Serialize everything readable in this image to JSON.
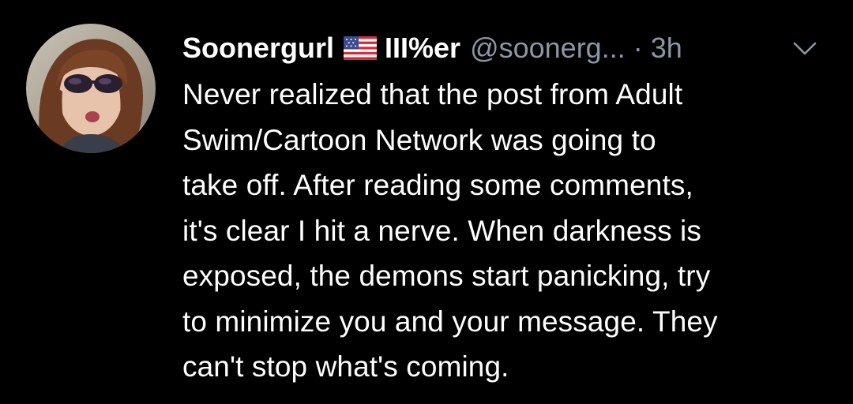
{
  "tweet": {
    "author": {
      "display_name": "Soonergurl",
      "flag_icon": "us-flag-icon",
      "name_suffix": "III%er",
      "handle": "@soonerg...",
      "avatar_icon": "profile-photo-avatar"
    },
    "separator": "·",
    "timestamp": "3h",
    "menu_icon": "chevron-down-icon",
    "body_lines": [
      "Never realized that the post from Adult",
      "Swim/Cartoon Network was going to",
      "take off. After reading some comments,",
      "it's clear I hit a nerve. When darkness is",
      "exposed, the demons start panicking, try",
      "to minimize you and your message. They",
      "can't stop what's coming."
    ]
  },
  "colors": {
    "background": "#000000",
    "primary_text": "#ffffff",
    "secondary_text": "#8899a6"
  }
}
